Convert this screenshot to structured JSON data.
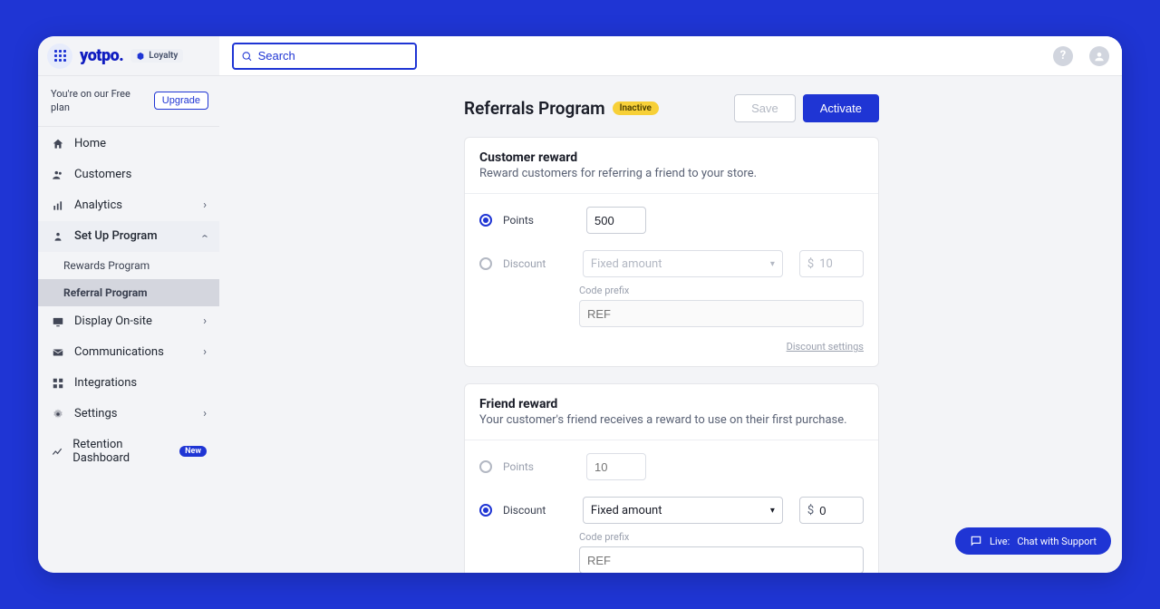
{
  "brand": {
    "logo": "yotpo.",
    "product": "Loyalty"
  },
  "plan": {
    "text": "You're on our Free plan",
    "upgrade": "Upgrade"
  },
  "search": {
    "placeholder": "Search"
  },
  "nav": {
    "home": "Home",
    "customers": "Customers",
    "analytics": "Analytics",
    "setup": "Set Up Program",
    "sub_rewards": "Rewards Program",
    "sub_referral": "Referral Program",
    "display": "Display On-site",
    "communications": "Communications",
    "integrations": "Integrations",
    "settings": "Settings",
    "retention": "Retention Dashboard",
    "new_badge": "New"
  },
  "page": {
    "title": "Referrals Program",
    "status": "Inactive",
    "save": "Save",
    "activate": "Activate"
  },
  "customer_reward": {
    "title": "Customer reward",
    "subtitle": "Reward customers for referring a friend to your store.",
    "points_label": "Points",
    "points_value": "500",
    "discount_label": "Discount",
    "discount_type": "Fixed amount",
    "currency": "$",
    "discount_value": "10",
    "code_prefix_label": "Code prefix",
    "code_prefix_value": "REF",
    "discount_settings": "Discount settings"
  },
  "friend_reward": {
    "title": "Friend reward",
    "subtitle": "Your customer's friend receives a reward to use on their first purchase.",
    "points_label": "Points",
    "points_value": "10",
    "discount_label": "Discount",
    "discount_type": "Fixed amount",
    "currency": "$",
    "discount_value": "0",
    "code_prefix_label": "Code prefix",
    "code_prefix_value": "REF"
  },
  "help": {
    "chat": "Chat with Support",
    "live": "Live:"
  }
}
